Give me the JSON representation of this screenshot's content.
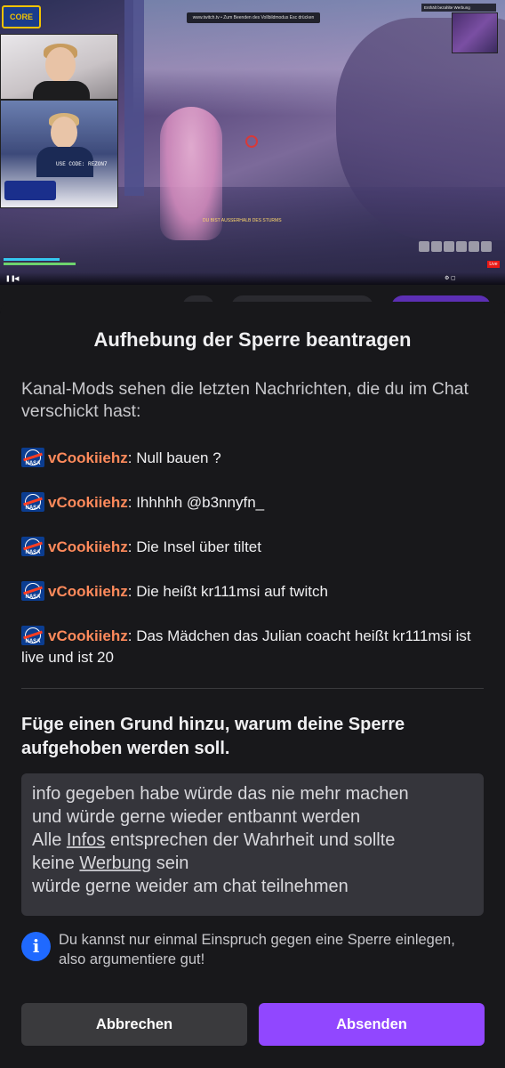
{
  "video": {
    "logo": "CORE",
    "esc_hint": "www.twitch.tv • Zum Beenden des Vollbildmodus Esc drücken",
    "ad_label": "Enthält bezahlte Werbung",
    "cam_label": "USE CODE: REZON7",
    "hud_text": "DU BIST AUSSERHALB DES STURMS",
    "live_label": "Live",
    "pause_icon": "pause-icon",
    "volume_icon": "volume-icon"
  },
  "sheet": {
    "title": "Aufhebung der Sperre beantragen",
    "intro": "Kanal-Mods sehen die letzten Nachrichten, die du im Chat verschickt hast:",
    "messages": [
      {
        "user": "vCookiiehz",
        "text": ": Null bauen ?"
      },
      {
        "user": "vCookiiehz",
        "text": ": Ihhhhh @b3nnyfn_"
      },
      {
        "user": "vCookiiehz",
        "text": ": Die Insel über tiltet"
      },
      {
        "user": "vCookiiehz",
        "text": ": Die heißt kr111msi auf twitch"
      },
      {
        "user": "vCookiiehz",
        "text": ": Das Mädchen das Julian coacht heißt kr111msi ist live und ist 20"
      }
    ],
    "badge_label": "NASA",
    "reason_title": "Füge einen Grund hinzu, warum deine Sperre aufgehoben werden soll.",
    "reason_lines": [
      "info gegeben habe würde das nie mehr machen",
      "und würde gerne wieder entbannt werden",
      "Alle ",
      "Infos",
      " entsprechen der Wahrheit und sollte",
      "keine ",
      "Werbung",
      " sein",
      "würde gerne weider am chat teilnehmen"
    ],
    "info_text": "Du kannst nur einmal Einspruch gegen eine Sperre einlegen, also argumentiere gut!",
    "cancel_label": "Abbrechen",
    "submit_label": "Absenden"
  },
  "colors": {
    "accent": "#9147ff",
    "username": "#ff8a5b",
    "info": "#1f69ff"
  }
}
